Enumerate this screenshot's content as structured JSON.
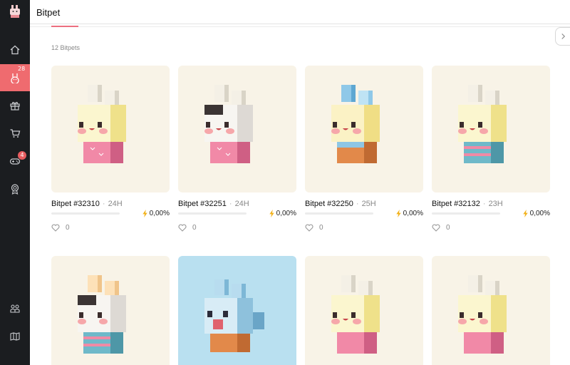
{
  "header": {
    "title": "Bitpet"
  },
  "list": {
    "count_label": "12 Bitpets"
  },
  "sidebar": {
    "items": [
      {
        "name": "home",
        "icon": "home-icon",
        "badge": ""
      },
      {
        "name": "bitpets",
        "icon": "bunny-icon",
        "badge": "28",
        "active": true
      },
      {
        "name": "gifts",
        "icon": "gift-icon",
        "badge": ""
      },
      {
        "name": "shop",
        "icon": "cart-icon",
        "badge": ""
      },
      {
        "name": "games",
        "icon": "gamepad-icon",
        "badge": "4"
      },
      {
        "name": "rewards",
        "icon": "medal-icon",
        "badge": ""
      },
      {
        "name": "friends",
        "icon": "users-icon",
        "badge": ""
      },
      {
        "name": "wallet",
        "icon": "map-icon",
        "badge": ""
      }
    ]
  },
  "cards": [
    {
      "name": "Bitpet #32310",
      "time": "24H",
      "energy": "0,00%",
      "likes": "0",
      "variant": "cream"
    },
    {
      "name": "Bitpet #32251",
      "time": "24H",
      "energy": "0,00%",
      "likes": "0",
      "variant": "panda"
    },
    {
      "name": "Bitpet #32250",
      "time": "25H",
      "energy": "0,00%",
      "likes": "0",
      "variant": "bluebear"
    },
    {
      "name": "Bitpet #32132",
      "time": "23H",
      "energy": "0,00%",
      "likes": "0",
      "variant": "stripes"
    },
    {
      "variant": "pandaPeach"
    },
    {
      "variant": "blueMonster"
    },
    {
      "variant": "cream"
    },
    {
      "variant": "cream"
    }
  ],
  "colors": {
    "sidebar_bg": "#1b1d20",
    "active_nav": "#ef6b6f",
    "card_bg": "#f8f3e7",
    "card_bg_blue": "#b9e0f0",
    "accent_tab": "#ec6f80",
    "energy": "#f2b21b"
  }
}
